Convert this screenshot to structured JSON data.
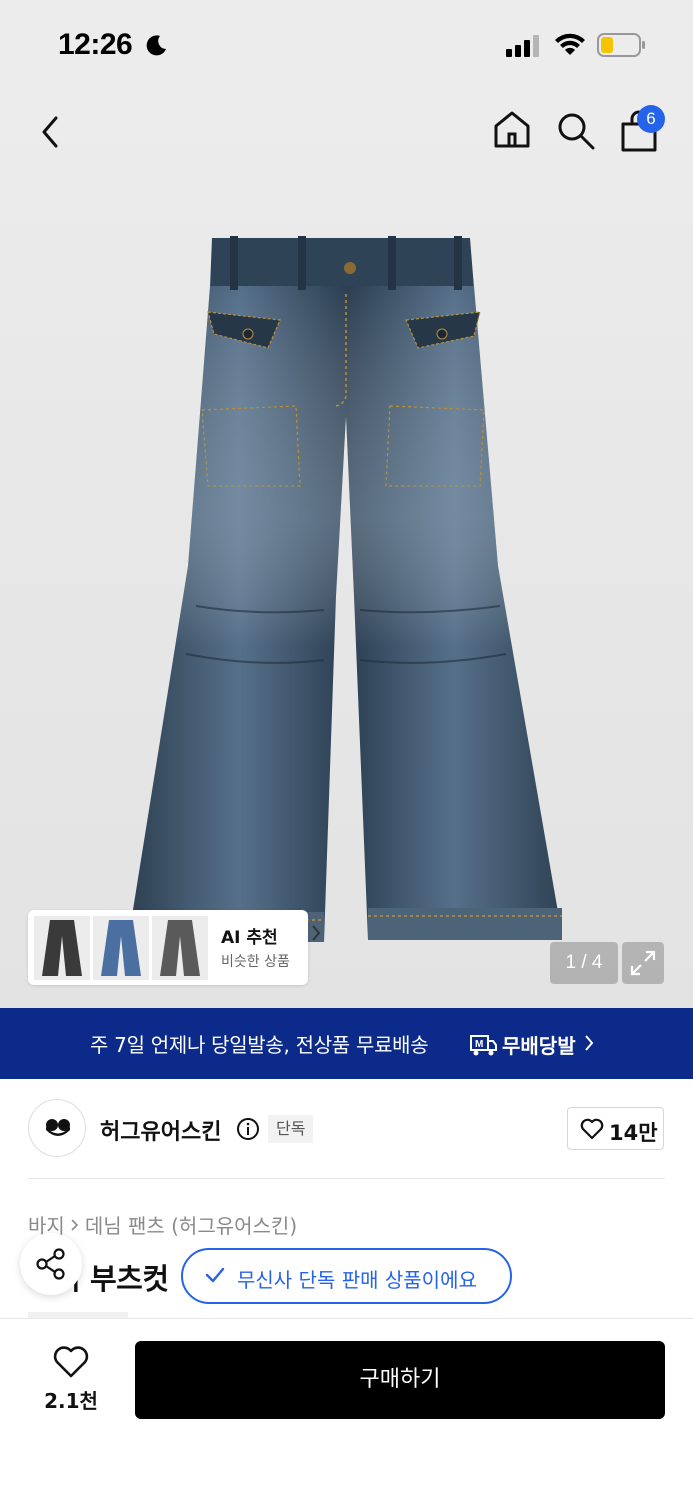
{
  "status_bar": {
    "time": "12:26"
  },
  "nav": {
    "cart_count": "6"
  },
  "gallery": {
    "counter": "1 / 4",
    "ai_title": "AI 추천",
    "ai_subtitle": "비슷한 상품",
    "thumb_colors": [
      "#3a3a3a",
      "#4a6fa0",
      "#5a5a5a"
    ]
  },
  "banner": {
    "text": "주 7일 언제나 당일발송, 전상품 무료배송",
    "logo_label": "무배당발",
    "background": "#0c2a8a"
  },
  "brand": {
    "name": "허그유어스킨",
    "exclusive_label": "단독",
    "like_count": "14만"
  },
  "product": {
    "breadcrumb": [
      "바지",
      "데님 팬츠 (허그유어스킨)"
    ],
    "title_visible": "세미 부츠컷",
    "exclusive_pill": "무신사 단독 판매 상품이에요"
  },
  "bottom_bar": {
    "wish_count": "2.1천",
    "buy_label": "구매하기"
  },
  "colors": {
    "accent": "#2563eb",
    "denim": "#3f5468"
  }
}
